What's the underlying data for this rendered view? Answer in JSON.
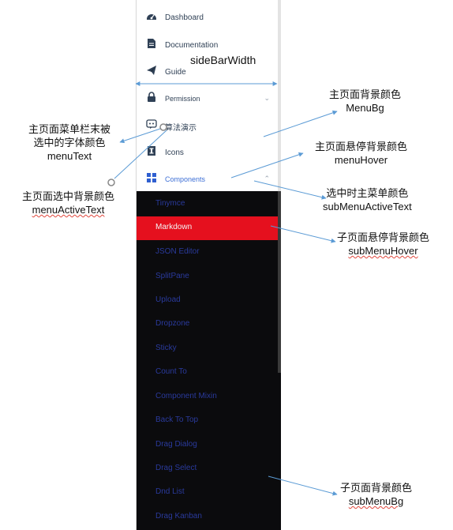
{
  "sidebar": {
    "items": [
      {
        "label": "Dashboard",
        "icon": "dashboard-icon"
      },
      {
        "label": "Documentation",
        "icon": "document-icon"
      },
      {
        "label": "Guide",
        "icon": "paper-plane-icon"
      },
      {
        "label": "Permission",
        "icon": "lock-icon",
        "chevron": "⌄"
      },
      {
        "label": "算法演示",
        "icon": "algorithm-icon"
      },
      {
        "label": "Icons",
        "icon": "info-icon"
      },
      {
        "label": "Components",
        "icon": "grid-icon",
        "chevron": "⌃"
      }
    ],
    "submenu": [
      {
        "label": "Tinymce"
      },
      {
        "label": "Markdown",
        "active": true
      },
      {
        "label": "JSON Editor"
      },
      {
        "label": "SplitPane"
      },
      {
        "label": "Upload"
      },
      {
        "label": "Dropzone"
      },
      {
        "label": "Sticky"
      },
      {
        "label": "Count To"
      },
      {
        "label": "Component Mixin"
      },
      {
        "label": "Back To Top"
      },
      {
        "label": "Drag Dialog"
      },
      {
        "label": "Drag Select"
      },
      {
        "label": "Dnd List"
      },
      {
        "label": "Drag Kanban"
      }
    ]
  },
  "annotations": {
    "sidebar_width": "sideBarWidth",
    "menu_bg": {
      "zh": "主页面背景颜色",
      "en": "MenuBg"
    },
    "menu_text": {
      "zh1": "主页面菜单栏末被",
      "zh2": "选中的字体颜色",
      "en": "menuText"
    },
    "menu_hover": {
      "zh": "主页面悬停背景颜色",
      "en": "menuHover"
    },
    "menu_active_text": {
      "zh": "主页面选中背景颜色",
      "en": "menuActiveText"
    },
    "sub_menu_active_text": {
      "zh": "选中时主菜单颜色",
      "en": "subMenuActiveText"
    },
    "sub_menu_hover": {
      "zh": "子页面悬停背景颜色",
      "en": "subMenuHover"
    },
    "sub_menu_bg": {
      "zh": "子页面背景颜色",
      "en": "subMenuBg"
    }
  },
  "colors": {
    "menu_text": "#304156",
    "submenu_bg": "#0b0b0d",
    "submenu_text": "#2a3a9c",
    "submenu_hover": "#e5101e",
    "active_text": "#3d6fd6",
    "annotation_line": "#5b9bd5"
  }
}
